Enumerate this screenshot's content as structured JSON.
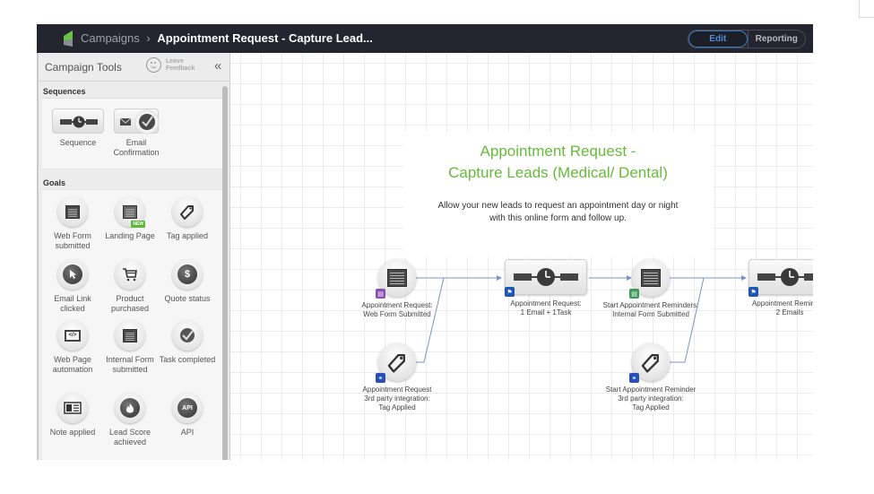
{
  "header": {
    "breadcrumb_root": "Campaigns",
    "breadcrumb_separator": "›",
    "breadcrumb_current": "Appointment Request - Capture Lead...",
    "modes": [
      {
        "label": "Edit",
        "active": true
      },
      {
        "label": "Reporting",
        "active": false
      }
    ]
  },
  "sidebar": {
    "title": "Campaign Tools",
    "feedback_line1": "Leave",
    "feedback_line2": "Feedback",
    "collapse_icon": "«",
    "sections": {
      "sequences": {
        "heading": "Sequences",
        "items": [
          {
            "label": "Sequence",
            "icon": "sequence-clock-icon"
          },
          {
            "label": "Email Confirmation",
            "icon": "email-check-icon"
          }
        ]
      },
      "goals": {
        "heading": "Goals",
        "items": [
          {
            "label": "Web Form submitted",
            "icon": "web-form-icon"
          },
          {
            "label": "Landing Page",
            "icon": "landing-page-icon",
            "badge": "NEW"
          },
          {
            "label": "Tag applied",
            "icon": "tag-icon"
          },
          {
            "label": "Email Link clicked",
            "icon": "cursor-icon"
          },
          {
            "label": "Product purchased",
            "icon": "cart-icon"
          },
          {
            "label": "Quote status",
            "icon": "dollar-icon",
            "glyph": "$"
          },
          {
            "label": "Web Page automation",
            "icon": "code-icon",
            "glyph": "</>"
          },
          {
            "label": "Internal Form submitted",
            "icon": "internal-form-icon"
          },
          {
            "label": "Task completed",
            "icon": "task-check-icon"
          },
          {
            "label": "Note applied",
            "icon": "note-card-icon"
          },
          {
            "label": "Lead Score achieved",
            "icon": "flame-icon"
          },
          {
            "label": "API",
            "icon": "api-icon",
            "glyph": "API"
          }
        ]
      }
    }
  },
  "canvas": {
    "title": "Appointment Request - Capture Leads (Medical/ Dental)",
    "title_line1": "Appointment Request -",
    "title_line2": "Capture Leads (Medical/ Dental)",
    "description_line1": "Allow your new leads to request an appointment day or night",
    "description_line2": "with this online form and follow up.",
    "accent_color": "#66bb3a",
    "connector_color": "#7b93c8",
    "nodes": [
      {
        "id": "n1",
        "type": "goal",
        "icon": "web-form-icon",
        "badge": "form-badge",
        "badge_color": "#8a4fb3",
        "label_line1": "Appointment Request:",
        "label_line2": "Web Form Submitted"
      },
      {
        "id": "n2",
        "type": "goal",
        "icon": "tag-icon",
        "badge": "integration-badge",
        "badge_color": "#2a4fb8",
        "label_line1": "Appointment Request",
        "label_line2": "3rd party integration:",
        "label_line3": "Tag Applied"
      },
      {
        "id": "n3",
        "type": "sequence",
        "icon": "sequence-clock-icon",
        "badge": "flag-badge",
        "badge_color": "#1f56b5",
        "label_line1": "Appointment Request:",
        "label_line2": "1 Email + 1Task"
      },
      {
        "id": "n4",
        "type": "goal",
        "icon": "internal-form-icon",
        "badge": "internal-form-badge",
        "badge_color": "#3f9a5a",
        "label_line1": "Start Appointment Reminders:",
        "label_line2": "Internal Form Submitted"
      },
      {
        "id": "n5",
        "type": "goal",
        "icon": "tag-icon",
        "badge": "integration-badge",
        "badge_color": "#2a4fb8",
        "label_line1": "Start Appointment Reminder",
        "label_line2": "3rd party integration:",
        "label_line3": "Tag Applied"
      },
      {
        "id": "n6",
        "type": "sequence",
        "icon": "sequence-clock-icon",
        "badge": "flag-badge",
        "badge_color": "#1f56b5",
        "label_line1": "Appointment Reminder:",
        "label_line2": "2 Emails"
      }
    ]
  }
}
